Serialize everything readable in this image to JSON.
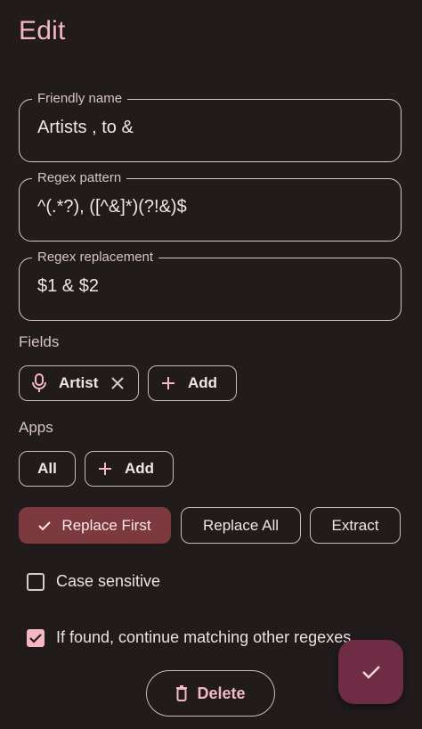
{
  "header": {
    "title": "Edit"
  },
  "form": {
    "friendly_name": {
      "label": "Friendly name",
      "value": "Artists , to &"
    },
    "regex_pattern": {
      "label": "Regex pattern",
      "value": "^(.*?), ([^&]*)(?!&)$"
    },
    "regex_replacement": {
      "label": "Regex replacement",
      "value": "$1 & $2"
    }
  },
  "fields": {
    "label": "Fields",
    "chips": [
      {
        "label": "Artist",
        "icon": "microphone-icon"
      }
    ],
    "add_label": "Add"
  },
  "apps": {
    "label": "Apps",
    "all_label": "All",
    "add_label": "Add"
  },
  "mode": {
    "options": [
      "Replace First",
      "Replace All",
      "Extract"
    ],
    "selected": "Replace First"
  },
  "options": {
    "case_sensitive": {
      "label": "Case sensitive",
      "checked": false
    },
    "continue_matching": {
      "label": "If found, continue matching other regexes",
      "checked": true
    }
  },
  "actions": {
    "delete_label": "Delete"
  },
  "colors": {
    "accent": "#f3b8c2",
    "selected_bg": "#7c3a3e",
    "fab_bg": "#6e2c45",
    "background": "#211b1c"
  }
}
